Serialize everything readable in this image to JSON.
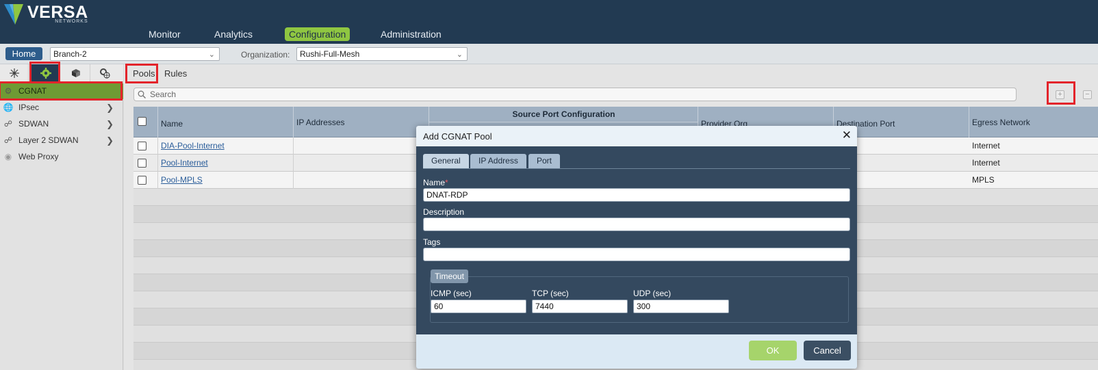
{
  "header": {
    "logo_text": "VERSA",
    "logo_sub": "NETWORKS",
    "nav": [
      {
        "label": "Monitor"
      },
      {
        "label": "Analytics"
      },
      {
        "label": "Configuration",
        "active": true
      },
      {
        "label": "Administration"
      }
    ]
  },
  "toolbar": {
    "home_label": "Home",
    "appliance": "Branch-2",
    "org_label": "Organization:",
    "organization": "Rushi-Full-Mesh"
  },
  "left_panel": {
    "tab_icons": [
      "network-icon",
      "gear-icon",
      "cube-icon",
      "gear-globe-icon"
    ],
    "items": [
      {
        "label": "CGNAT",
        "icon": "cgnat-icon",
        "active": true
      },
      {
        "label": "IPsec",
        "icon": "globe-lock-icon",
        "expandable": true
      },
      {
        "label": "SDWAN",
        "icon": "sdwan-icon",
        "expandable": true
      },
      {
        "label": "Layer 2 SDWAN",
        "icon": "layer2-icon",
        "expandable": true
      },
      {
        "label": "Web Proxy",
        "icon": "globe-icon"
      }
    ]
  },
  "main": {
    "tabs": [
      {
        "label": "Pools",
        "active": true
      },
      {
        "label": "Rules"
      }
    ],
    "search_placeholder": "Search",
    "columns": {
      "name": "Name",
      "ip_addresses": "IP Addresses",
      "source_port_group": "Source Port Configuration",
      "provider_org": "Provider Org",
      "destination_port": "Destination Port",
      "egress_network": "Egress Network"
    },
    "rows": [
      {
        "name": "DIA-Pool-Internet",
        "egress": "Internet"
      },
      {
        "name": "Pool-Internet",
        "egress": "Internet"
      },
      {
        "name": "Pool-MPLS",
        "egress": "MPLS"
      }
    ]
  },
  "modal": {
    "title": "Add CGNAT Pool",
    "tabs": [
      {
        "label": "General",
        "active": true
      },
      {
        "label": "IP Address"
      },
      {
        "label": "Port"
      }
    ],
    "name_label": "Name",
    "required_mark": "*",
    "name_value": "DNAT-RDP",
    "description_label": "Description",
    "description_value": "",
    "tags_label": "Tags",
    "tags_value": "",
    "timeout": {
      "legend": "Timeout",
      "icmp_label": "ICMP (sec)",
      "icmp_value": "60",
      "tcp_label": "TCP (sec)",
      "tcp_value": "7440",
      "udp_label": "UDP (sec)",
      "udp_value": "300"
    },
    "ok_label": "OK",
    "cancel_label": "Cancel"
  },
  "colors": {
    "header_bg": "#223a52",
    "accent_green": "#8fc641",
    "highlight_red": "#e3242b",
    "modal_bg": "#34495f"
  }
}
